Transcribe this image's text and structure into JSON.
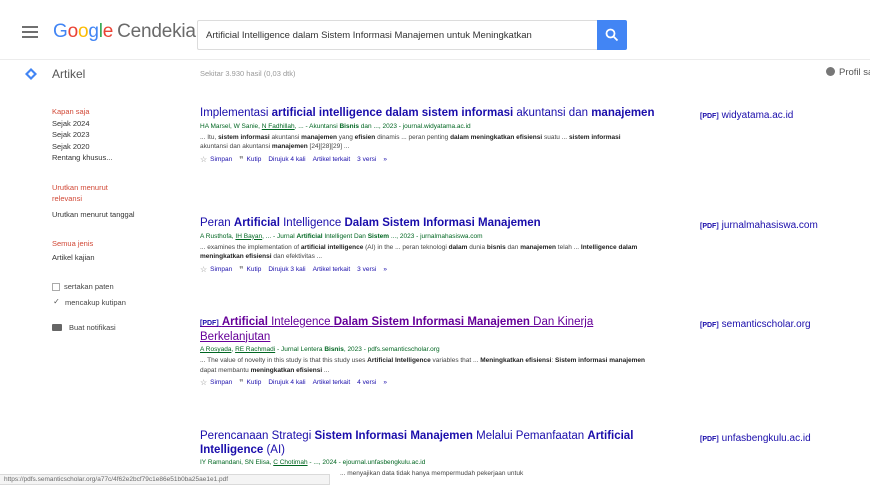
{
  "header": {
    "brand_google": [
      "G",
      "o",
      "o",
      "g",
      "l",
      "e"
    ],
    "brand_cendekia": "Cendekia",
    "search_value": "Artificial Intelligence dalam Sistem Informasi Manajemen untuk Meningkatkan"
  },
  "subbar": {
    "section_label": "Artikel",
    "result_count": "Sekitar 3.930 hasil (0,03 dtk)",
    "profile_label": "Profil saya"
  },
  "sidebar": {
    "time_filters": [
      "Kapan saja",
      "Sejak 2024",
      "Sejak 2023",
      "Sejak 2020",
      "Rentang khusus..."
    ],
    "sort_options": [
      "Urutkan menurut relevansi",
      "Urutkan menurut tanggal"
    ],
    "type_options": [
      "Semua jenis",
      "Artikel kajian"
    ],
    "checkboxes": [
      {
        "label": "sertakan paten",
        "checked": false
      },
      {
        "label": "mencakup kutipan",
        "checked": true
      }
    ],
    "alert_label": "Buat notifikasi"
  },
  "results": [
    {
      "title_html": "Implementasi <b>artificial intelligence dalam sistem informasi</b> akuntansi dan <b>manajemen</b>",
      "meta_html": "HA Marsel, W Sanie, <u>N Fadhillah</u>, ... - Akuntansi <b>Bisnis</b> dan ..., 2023 - journal.widyatama.ac.id",
      "snippet_html": "... Itu, <b>sistem informasi</b> akuntansi <b>manajemen</b> yang <b>efisien</b> dinamis ... peran penting <b>dalam meningkatkan efisiensi</b> suatu ... <b>sistem informasi</b> akuntansi dan akuntansi <b>manajemen</b> [24][28][29] ...",
      "cited_by": "Dirujuk 4 kali",
      "related": "Artikel terkait",
      "versions": "3 versi",
      "pdf_source": "widyatama.ac.id",
      "visited": false
    },
    {
      "title_html": "Peran <b>Artificial</b> Intelligence <b>Dalam Sistem Informasi Manajemen</b>",
      "meta_html": "A Rusthofa, <u>IH Bayan</u>, ... - Jurnal <b>Artificial</b> Intelligent Dan <b>Sistem</b> ..., 2023 - jurnalmahasiswa.com",
      "snippet_html": "... examines the implementation of <b>artificial intelligence</b> (AI) in the ... peran teknologi <b>dalam</b> dunia <b>bisnis</b> dan <b>manajemen</b> telah ... <b>Intelligence dalam meningkatkan efisiensi</b> dan efektivitas ...",
      "cited_by": "Dirujuk 3 kali",
      "related": "Artikel terkait",
      "versions": "3 versi",
      "pdf_source": "jurnalmahasiswa.com",
      "visited": false
    },
    {
      "title_html": "<span class='tag'>[PDF]</span> <b>Artificial</b> Intelegence <b>Dalam Sistem Informasi Manajemen</b> Dan Kinerja Berkelanjutan",
      "meta_html": "<u>A Rosyada</u>, <u>RE Rachmadi</u> - Jurnal Lentera <b>Bisnis</b>, 2023 - pdfs.semanticscholar.org",
      "snippet_html": "... The value of novelty in this study is that this study uses <b>Artificial Intelligence</b> variables that ... <b>Meningkatkan efisiensi</b>: <b>Sistem informasi manajemen</b> dapat membantu <b>meningkatkan efisiensi</b> ...",
      "cited_by": "Dirujuk 4 kali",
      "related": "Artikel terkait",
      "versions": "4 versi",
      "pdf_source": "semanticscholar.org",
      "visited": true
    },
    {
      "title_html": "Perencanaan Strategi <b>Sistem Informasi Manajemen</b> Melalui Pemanfaatan <b>Artificial Intelligence</b> (AI)",
      "meta_html": "IY Ramandani, SN Elisa, <u>C Chotimah</u> - ..., 2024 - ejournal.unfasbengkulu.ac.id",
      "snippet_html": "... menyajikan data tidak hanya mempermudah pekerjaan untuk",
      "cited_by": "",
      "related": "",
      "versions": "",
      "pdf_source": "unfasbengkulu.ac.id",
      "visited": false
    }
  ],
  "actions": {
    "save": "Simpan",
    "cite": "Kutip"
  },
  "pdf_tag": "[PDF]",
  "status_url": "https://pdfs.semanticscholar.org/a77c/4f62e2bcf79c1e86e51b0ba25ae1e1.pdf"
}
